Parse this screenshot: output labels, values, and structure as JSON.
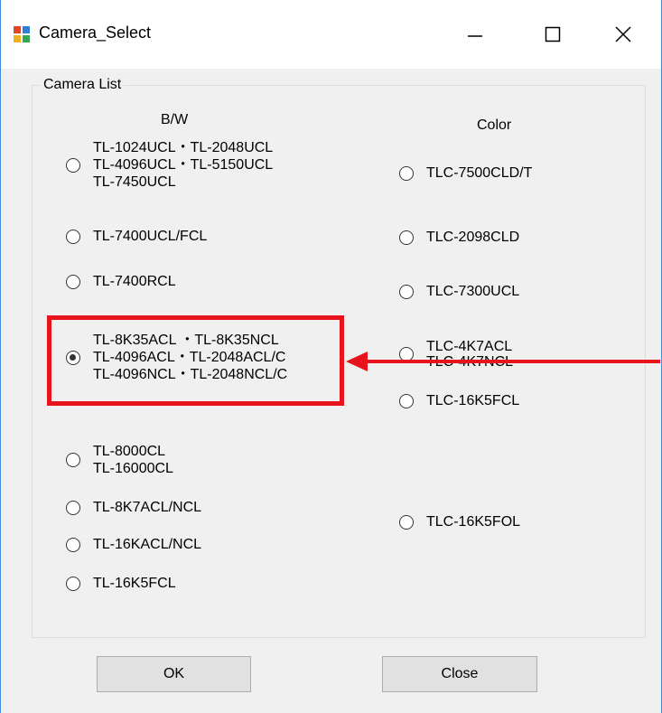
{
  "window": {
    "title": "Camera_Select",
    "icon": "app-window-icon",
    "controls": [
      "minimize-icon",
      "maximize-icon",
      "close-icon"
    ]
  },
  "group": {
    "label": "Camera List"
  },
  "columns": {
    "bw": "B/W",
    "color": "Color"
  },
  "bw_options": [
    {
      "lines": [
        "TL-1024UCL・TL-2048UCL",
        "TL-4096UCL・TL-5150UCL",
        "TL-7450UCL"
      ],
      "selected": false
    },
    {
      "lines": [
        "TL-7400UCL/FCL"
      ],
      "selected": false
    },
    {
      "lines": [
        "TL-7400RCL"
      ],
      "selected": false
    },
    {
      "lines": [
        "TL-8K35ACL ・TL-8K35NCL",
        "TL-4096ACL・TL-2048ACL/C",
        "TL-4096NCL・TL-2048NCL/C"
      ],
      "selected": true
    },
    {
      "lines": [
        "TL-8000CL",
        "TL-16000CL"
      ],
      "selected": false
    },
    {
      "lines": [
        "TL-8K7ACL/NCL"
      ],
      "selected": false
    },
    {
      "lines": [
        "TL-16KACL/NCL"
      ],
      "selected": false
    },
    {
      "lines": [
        "TL-16K5FCL"
      ],
      "selected": false
    }
  ],
  "color_options": [
    {
      "lines": [
        "TLC-7500CLD/T"
      ],
      "selected": false
    },
    {
      "lines": [
        "TLC-2098CLD"
      ],
      "selected": false
    },
    {
      "lines": [
        "TLC-7300UCL"
      ],
      "selected": false
    },
    {
      "lines": [
        "TLC-4K7ACL",
        "TLC-4K7NCL"
      ],
      "selected": false
    },
    {
      "lines": [
        "TLC-16K5FCL"
      ],
      "selected": false
    },
    {
      "lines": [
        "TLC-16K5FOL"
      ],
      "selected": false
    }
  ],
  "buttons": {
    "ok": "OK",
    "close": "Close"
  },
  "colors": {
    "highlight": "#e8141b",
    "window_border": "#3c8fd8"
  }
}
